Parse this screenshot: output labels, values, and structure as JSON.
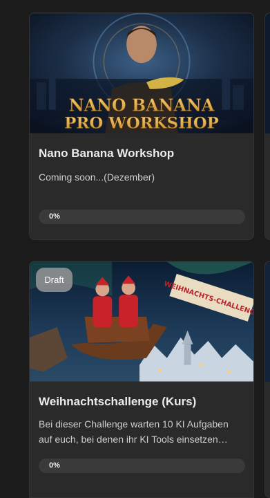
{
  "courses": [
    {
      "image_text_line1": "NANO BANANA",
      "image_text_line2": "PRO WORKSHOP",
      "title": "Nano Banana Workshop",
      "description": "Coming soon...(Dezember)",
      "progress": 0,
      "progress_label": "0%"
    },
    {
      "badge": "Draft",
      "banner_text": "WEIHNACHTS-CHALLENGE",
      "title": "Weihnachtschallenge (Kurs)",
      "description": "Bei dieser Challenge warten 10 KI Aufgaben auf euch, bei denen ihr KI Tools einsetzen…",
      "progress": 0,
      "progress_label": "0%"
    }
  ],
  "colors": {
    "background": "#1b1b1b",
    "card": "#2a2a2a",
    "progress_track": "#3a3a3a",
    "accent_gold": "#e0a53a"
  }
}
